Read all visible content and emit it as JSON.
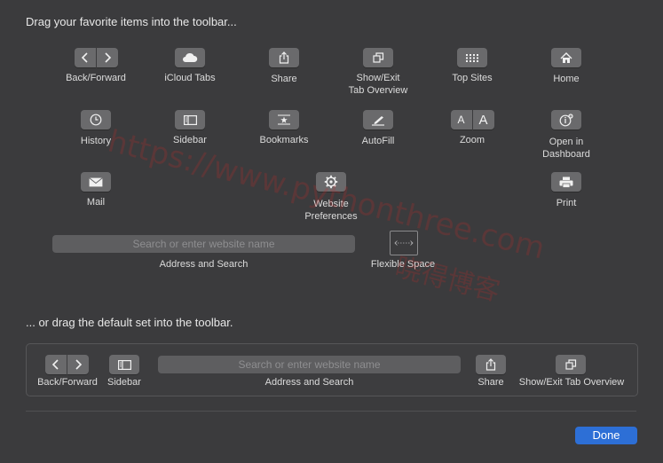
{
  "heading_top": "Drag your favorite items into the toolbar...",
  "heading_default": "... or drag the default set into the toolbar.",
  "items": {
    "back_forward": "Back/Forward",
    "icloud_tabs": "iCloud Tabs",
    "share": "Share",
    "show_exit": "Show/Exit\nTab Overview",
    "top_sites": "Top Sites",
    "home": "Home",
    "history": "History",
    "sidebar": "Sidebar",
    "bookmarks": "Bookmarks",
    "autofill": "AutoFill",
    "zoom": "Zoom",
    "open_dashboard": "Open in\nDashboard",
    "mail": "Mail",
    "website_prefs": "Website\nPreferences",
    "print": "Print",
    "address_search": "Address and Search",
    "flexible_space": "Flexible Space"
  },
  "zoom_small": "A",
  "zoom_large": "A",
  "search_placeholder": "Search or enter website name",
  "default_set": {
    "back_forward": "Back/Forward",
    "sidebar": "Sidebar",
    "address_search": "Address and Search",
    "search_placeholder": "Search or enter website name",
    "share": "Share",
    "show_exit": "Show/Exit Tab Overview"
  },
  "done_label": "Done",
  "watermark_line1": "https://www.pythonthree.com",
  "watermark_line2": "晓得博客",
  "icons": {
    "back": "chevron-left-icon",
    "forward": "chevron-right-icon",
    "cloud": "cloud-icon",
    "share": "share-icon",
    "tabs": "tabs-icon",
    "grid": "grid-icon",
    "home": "home-icon",
    "clock": "clock-icon",
    "sidebar": "sidebar-icon",
    "star": "star-icon",
    "pen": "pen-icon",
    "dashboard": "dashboard-icon",
    "mail": "envelope-icon",
    "gear": "gear-icon",
    "print": "printer-icon"
  },
  "colors": {
    "background": "#3b3b3d",
    "button": "#6a6a6c",
    "accent": "#2d6fd6"
  }
}
